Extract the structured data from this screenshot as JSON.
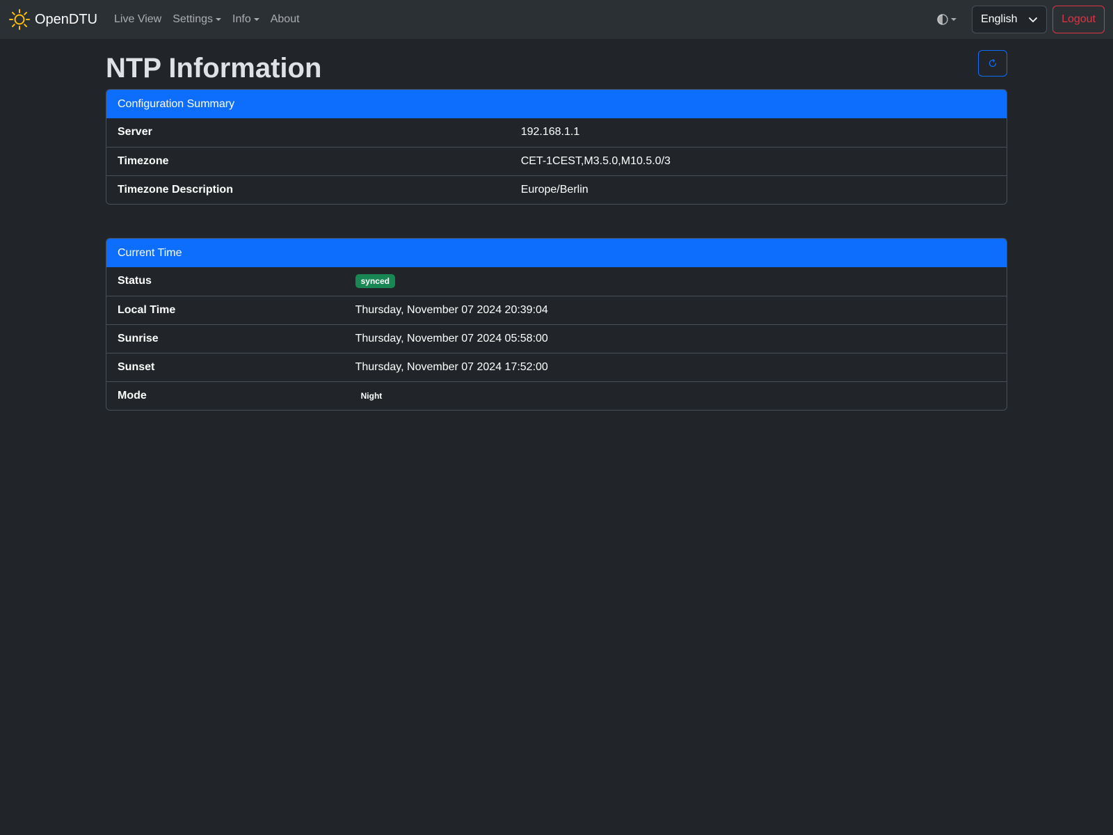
{
  "nav": {
    "brand": "OpenDTU",
    "links": [
      {
        "label": "Live View",
        "dropdown": false
      },
      {
        "label": "Settings",
        "dropdown": true
      },
      {
        "label": "Info",
        "dropdown": true
      },
      {
        "label": "About",
        "dropdown": false
      }
    ],
    "language": "English",
    "logout": "Logout"
  },
  "page": {
    "title": "NTP Information"
  },
  "config_summary": {
    "header": "Configuration Summary",
    "rows": [
      {
        "label": "Server",
        "value": "192.168.1.1"
      },
      {
        "label": "Timezone",
        "value": "CET-1CEST,M3.5.0,M10.5.0/3"
      },
      {
        "label": "Timezone Description",
        "value": "Europe/Berlin"
      }
    ]
  },
  "current_time": {
    "header": "Current Time",
    "status_label": "Status",
    "status_value": "synced",
    "local_time_label": "Local Time",
    "local_time_value": "Thursday, November 07 2024 20:39:04",
    "sunrise_label": "Sunrise",
    "sunrise_value": "Thursday, November 07 2024 05:58:00",
    "sunset_label": "Sunset",
    "sunset_value": "Thursday, November 07 2024 17:52:00",
    "mode_label": "Mode",
    "mode_value": "Night"
  },
  "colors": {
    "primary": "#0d6efd",
    "success": "#198754",
    "danger": "#dc3545",
    "sun": "#ffc107"
  },
  "icons": {
    "brand": "sun-icon",
    "theme": "contrast-icon",
    "language": "chevron-down-icon",
    "refresh": "refresh-icon"
  }
}
